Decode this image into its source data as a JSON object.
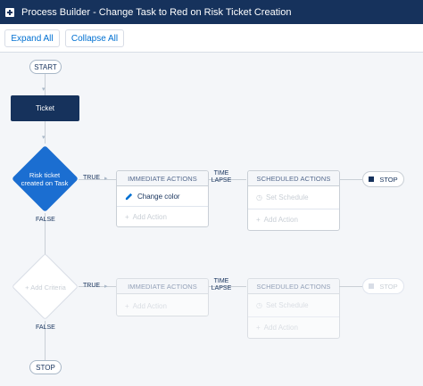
{
  "titlebar": {
    "title": "Process Builder - Change Task to Red on Risk Ticket Creation"
  },
  "toolbar": {
    "expand_label": "Expand All",
    "collapse_label": "Collapse All"
  },
  "flow": {
    "start_label": "START",
    "trigger_label": "Ticket",
    "criteria1_label": "Risk ticket created on Task",
    "criteria2_label": "Add Criteria",
    "true_label": "TRUE",
    "false_label": "FALSE",
    "end_stop_label": "STOP",
    "row1": {
      "immediate_header": "IMMEDIATE ACTIONS",
      "action1_label": "Change color",
      "add_action_label": "Add Action",
      "time_lapse_label": "TIME LAPSE",
      "scheduled_header": "SCHEDULED ACTIONS",
      "set_schedule_label": "Set Schedule",
      "scheduled_add_action_label": "Add Action",
      "stop_label": "STOP"
    },
    "row2": {
      "immediate_header": "IMMEDIATE ACTIONS",
      "add_action_label": "Add Action",
      "time_lapse_label": "TIME LAPSE",
      "scheduled_header": "SCHEDULED ACTIONS",
      "set_schedule_label": "Set Schedule",
      "scheduled_add_action_label": "Add Action",
      "stop_label": "STOP"
    }
  },
  "colors": {
    "titlebar": "#16325c",
    "accent": "#0070d2",
    "trigger_node": "#16325c",
    "criteria_node": "#1589ee"
  },
  "icons": [
    "add-icon",
    "pencil-icon",
    "clock-icon",
    "stop-icon",
    "chevron-down-icon",
    "arrow-right-icon"
  ]
}
